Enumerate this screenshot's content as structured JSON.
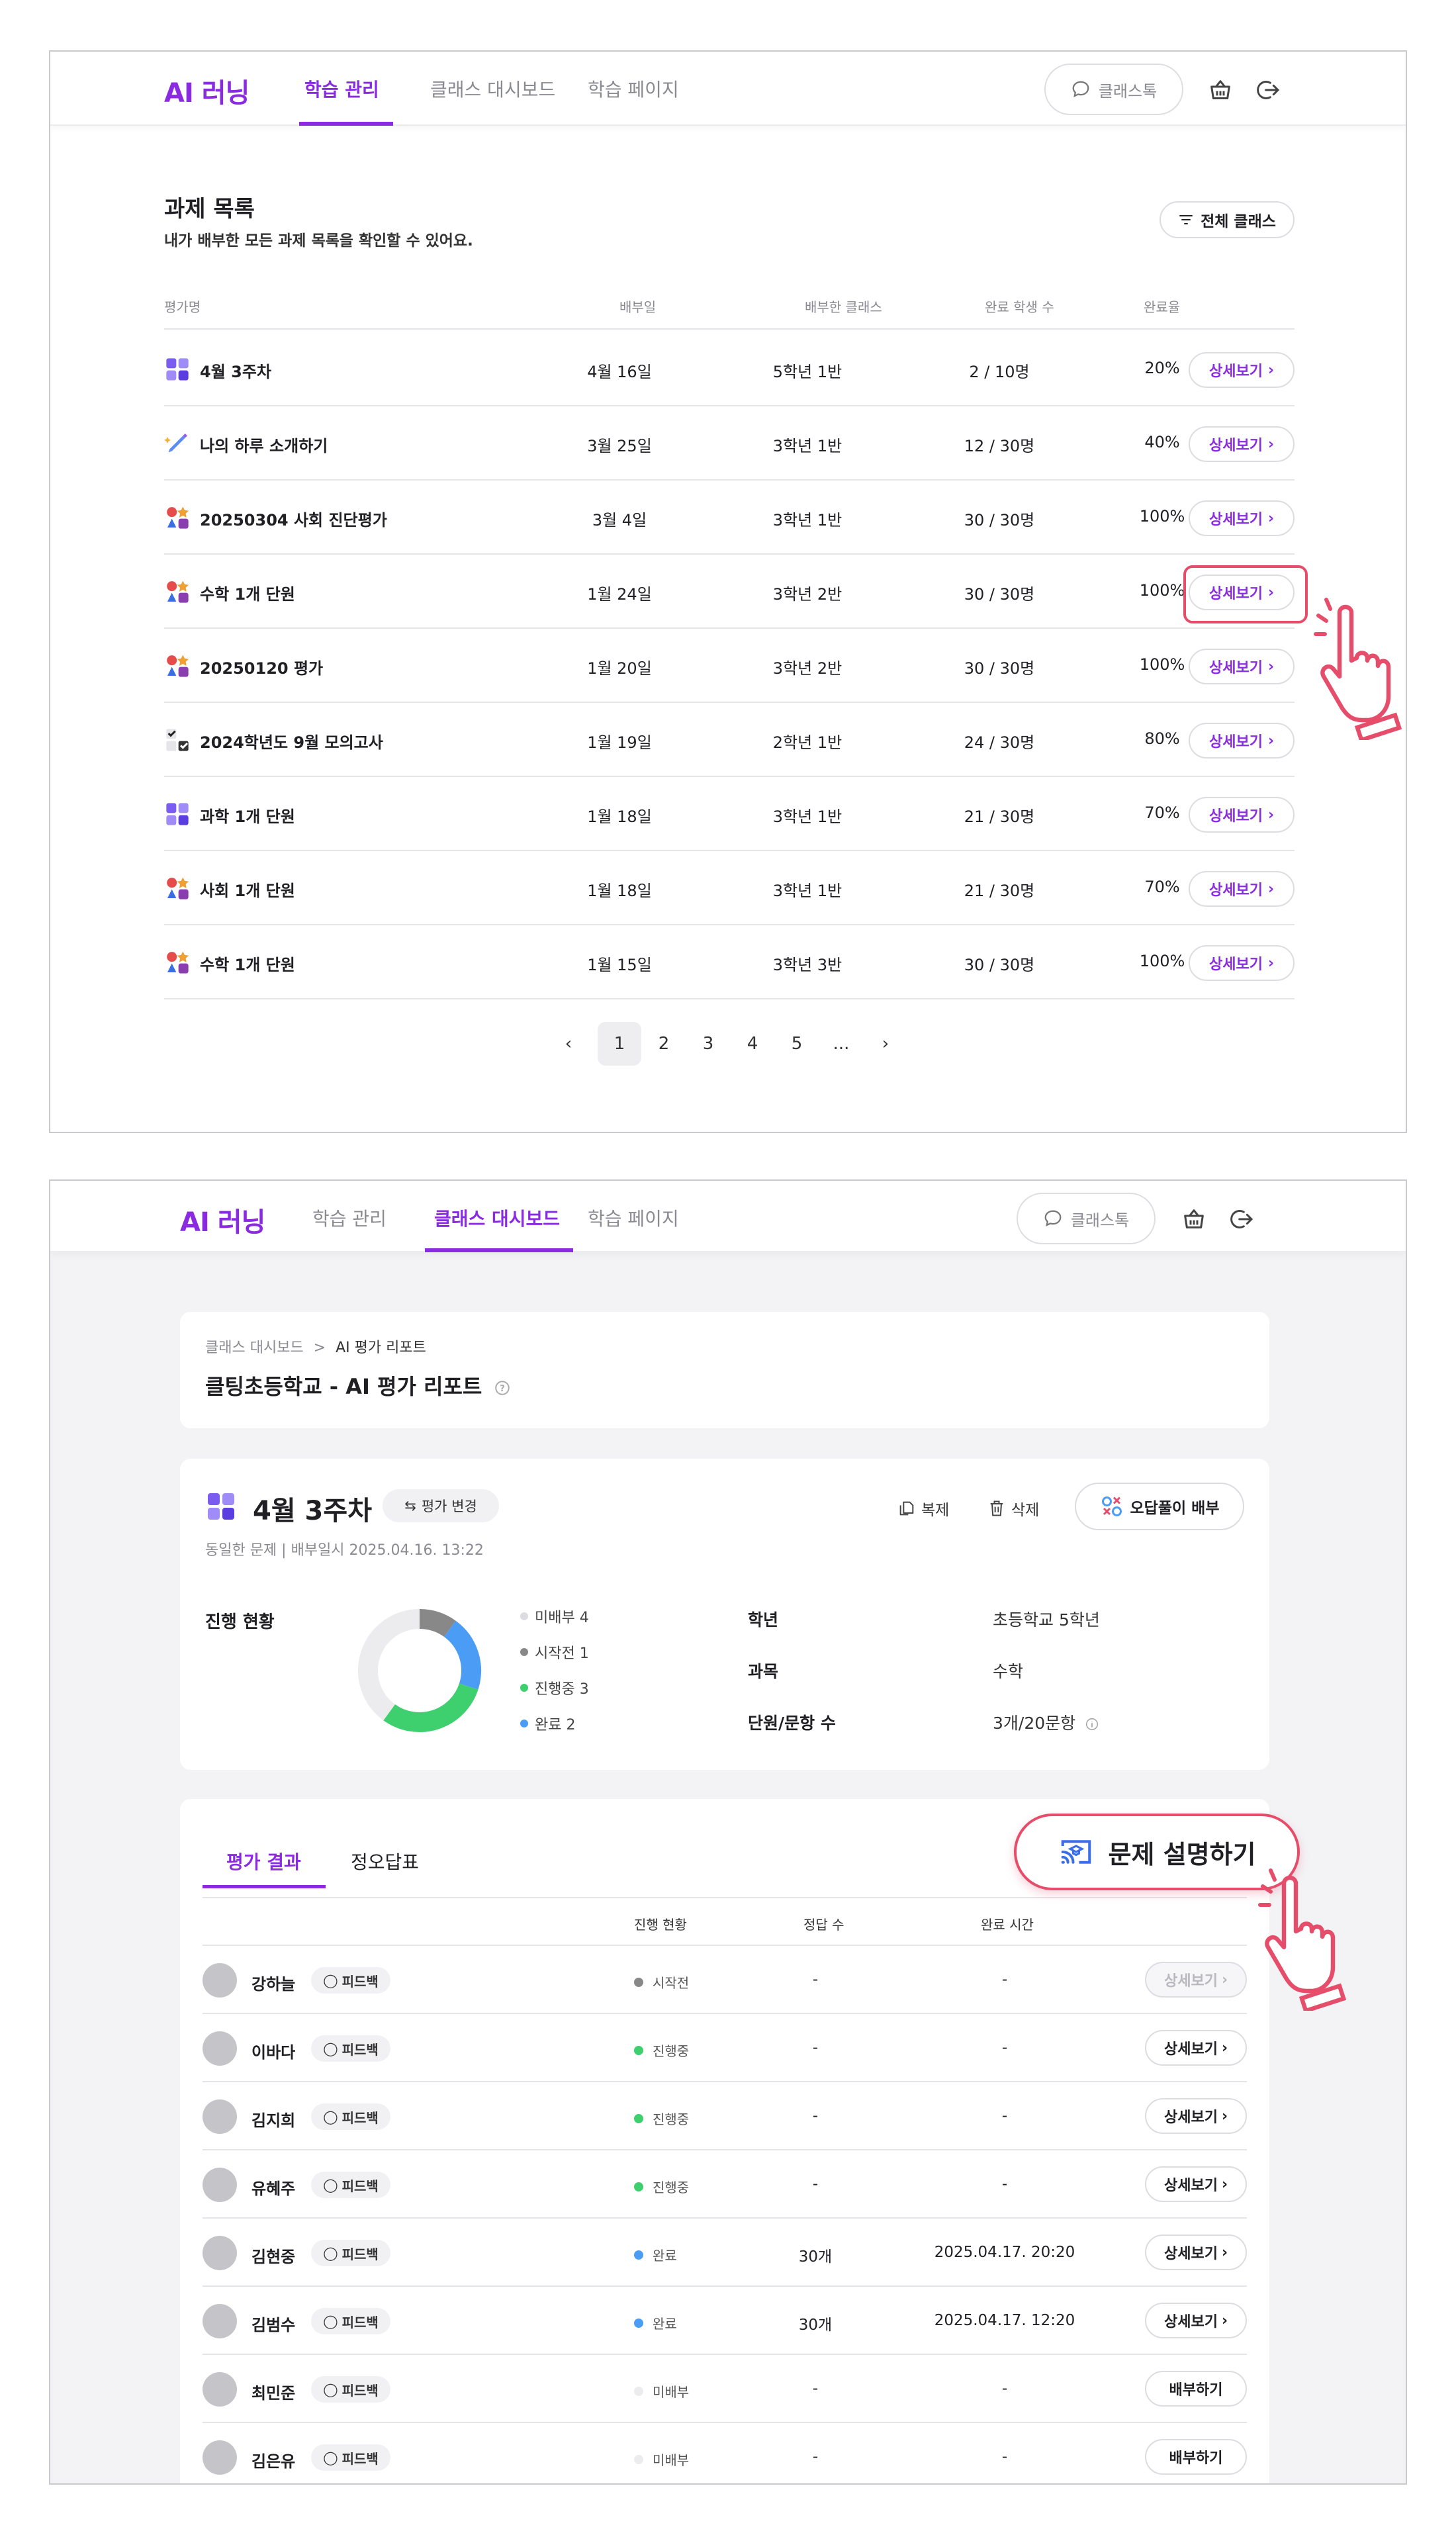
{
  "header": {
    "logo": "AI 러닝",
    "tabs": [
      "학습 관리",
      "클래스 대시보드",
      "학습 페이지"
    ],
    "chat_label": "클래스톡"
  },
  "colors": {
    "accent": "#8a2be2",
    "highlight": "#e54d6b",
    "not_distributed": "#dcdce1",
    "not_started": "#888888",
    "in_progress": "#3ecf6e",
    "completed": "#4a9cf5"
  },
  "assignments": {
    "title": "과제 목록",
    "subtitle": "내가 배부한 모든 과제 목록을 확인할 수 있어요.",
    "filter_label": "전체 클래스",
    "columns": [
      "평가명",
      "배부일",
      "배부한 클래스",
      "완료 학생 수",
      "완료율"
    ],
    "detail_label": "상세보기",
    "rows": [
      {
        "name": "4월 3주차",
        "date": "4월 16일",
        "class": "5학년 1반",
        "done": "2 / 10명",
        "rate": "20%",
        "icon": "grid-icon"
      },
      {
        "name": "나의 하루 소개하기",
        "date": "3월 25일",
        "class": "3학년 1반",
        "done": "12 / 30명",
        "rate": "40%",
        "icon": "pen-icon"
      },
      {
        "name": "20250304 사회 진단평가",
        "date": "3월 4일",
        "class": "3학년 1반",
        "done": "30 / 30명",
        "rate": "100%",
        "icon": "shapes-icon"
      },
      {
        "name": "수학 1개 단원",
        "date": "1월 24일",
        "class": "3학년 2반",
        "done": "30 / 30명",
        "rate": "100%",
        "icon": "shapes-icon"
      },
      {
        "name": "20250120 평가",
        "date": "1월 20일",
        "class": "3학년 2반",
        "done": "30 / 30명",
        "rate": "100%",
        "icon": "shapes-icon"
      },
      {
        "name": "2024학년도 9월 모의고사",
        "date": "1월 19일",
        "class": "2학년 1반",
        "done": "24 / 30명",
        "rate": "80%",
        "icon": "checklist-icon"
      },
      {
        "name": "과학 1개 단원",
        "date": "1월 18일",
        "class": "3학년 1반",
        "done": "21 / 30명",
        "rate": "70%",
        "icon": "grid-icon"
      },
      {
        "name": "사회 1개 단원",
        "date": "1월 18일",
        "class": "3학년 1반",
        "done": "21 / 30명",
        "rate": "70%",
        "icon": "shapes-icon"
      },
      {
        "name": "수학 1개 단원",
        "date": "1월 15일",
        "class": "3학년 3반",
        "done": "30 / 30명",
        "rate": "100%",
        "icon": "shapes-icon"
      }
    ],
    "pagination": {
      "prev": "‹",
      "pages": [
        "1",
        "2",
        "3",
        "4",
        "5",
        "..."
      ],
      "next": "›",
      "current": "1"
    }
  },
  "report": {
    "breadcrumb": [
      "클래스 대시보드",
      "AI 평가 리포트"
    ],
    "breadcrumb_sep": ">",
    "title": "클팅초등학교 - AI 평가 리포트",
    "eval_title": "4월 3주차",
    "change_label": "평가 변경",
    "meta": "동일한 문제 | 배부일시 2025.04.16. 13:22",
    "copy_label": "복제",
    "delete_label": "삭제",
    "wrong_label": "오답풀이 배부",
    "progress_label": "진행 현황",
    "progress": [
      {
        "label": "미배부 4",
        "value": 4,
        "color": "#dcdce1"
      },
      {
        "label": "시작전 1",
        "value": 1,
        "color": "#888888"
      },
      {
        "label": "진행중 3",
        "value": 3,
        "color": "#3ecf6e"
      },
      {
        "label": "완료 2",
        "value": 2,
        "color": "#4a9cf5"
      }
    ],
    "info": [
      {
        "k": "학년",
        "v": "초등학교 5학년"
      },
      {
        "k": "과목",
        "v": "수학"
      },
      {
        "k": "단원/문항 수",
        "v": "3개/20문항"
      }
    ]
  },
  "results": {
    "tabs": [
      "평가 결과",
      "정오답표"
    ],
    "explain_label": "문제 설명하기",
    "columns": [
      "진행 현황",
      "정답 수",
      "완료 시간"
    ],
    "feedback_label": "피드백",
    "students": [
      {
        "name": "강하늘",
        "status": "시작전",
        "correct": "-",
        "time": "-",
        "btn": "상세보기",
        "state": "notstarted"
      },
      {
        "name": "이바다",
        "status": "진행중",
        "correct": "-",
        "time": "-",
        "btn": "상세보기",
        "state": "progress"
      },
      {
        "name": "김지희",
        "status": "진행중",
        "correct": "-",
        "time": "-",
        "btn": "상세보기",
        "state": "progress"
      },
      {
        "name": "유혜주",
        "status": "진행중",
        "correct": "-",
        "time": "-",
        "btn": "상세보기",
        "state": "progress"
      },
      {
        "name": "김현중",
        "status": "완료",
        "correct": "30개",
        "time": "2025.04.17. 20:20",
        "btn": "상세보기",
        "state": "done"
      },
      {
        "name": "김범수",
        "status": "완료",
        "correct": "30개",
        "time": "2025.04.17. 12:20",
        "btn": "상세보기",
        "state": "done"
      },
      {
        "name": "최민준",
        "status": "미배부",
        "correct": "-",
        "time": "-",
        "btn": "배부하기",
        "state": "none"
      },
      {
        "name": "김은유",
        "status": "미배부",
        "correct": "-",
        "time": "-",
        "btn": "배부하기",
        "state": "none"
      }
    ]
  }
}
